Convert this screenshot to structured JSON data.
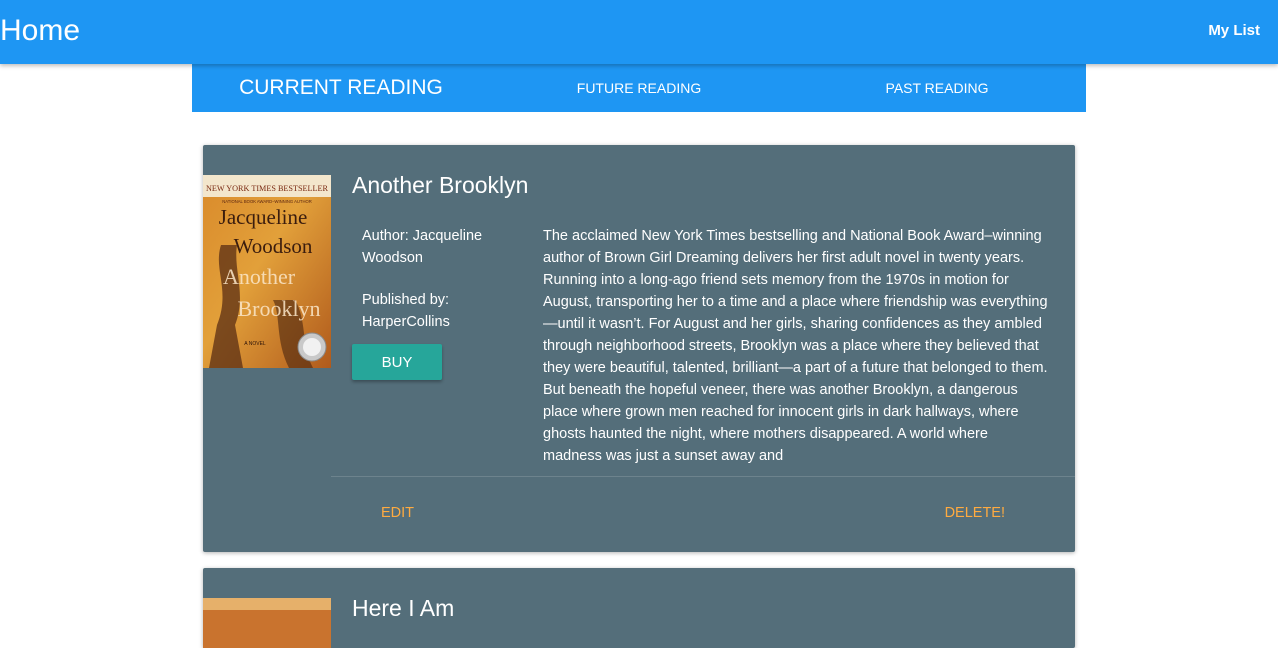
{
  "appbar": {
    "title": "Home",
    "my_list": "My List",
    "color": "#1e96f3"
  },
  "tabs": [
    {
      "label": "CURRENT READING",
      "active": true
    },
    {
      "label": "FUTURE READING",
      "active": false
    },
    {
      "label": "PAST READING",
      "active": false
    }
  ],
  "books": [
    {
      "title": "Another Brooklyn",
      "author": "Author: Jacqueline Woodson",
      "publisher": "Published by: HarperCollins",
      "buy_label": "BUY",
      "description": "The acclaimed New York Times bestselling and National Book Award–winning author of Brown Girl Dreaming delivers her first adult novel in twenty years. Running into a long-ago friend sets memory from the 1970s in motion for August, transporting her to a time and a place where friendship was everything—until it wasn’t. For August and her girls, sharing confidences as they ambled through neighborhood streets, Brooklyn was a place where they believed that they were beautiful, talented, brilliant—a part of a future that belonged to them. But beneath the hopeful veneer, there was another Brooklyn, a dangerous place where grown men reached for innocent girls in dark hallways, where ghosts haunted the night, where mothers disappeared. A world where madness was just a sunset away and",
      "edit_label": "EDIT",
      "delete_label": "DELETE!",
      "cover": {
        "banner": "NEW YORK TIMES BESTSELLER",
        "subbanner": "NATIONAL BOOK AWARD–WINNING AUTHOR",
        "author_line1": "Jacqueline",
        "author_line2": "Woodson",
        "title_line1": "Another",
        "title_line2": "Brooklyn",
        "tag": "A NOVEL"
      }
    },
    {
      "title": "Here I Am"
    }
  ],
  "colors": {
    "card": "#546e7a",
    "buy": "#26a69a",
    "action": "#ffab40"
  }
}
